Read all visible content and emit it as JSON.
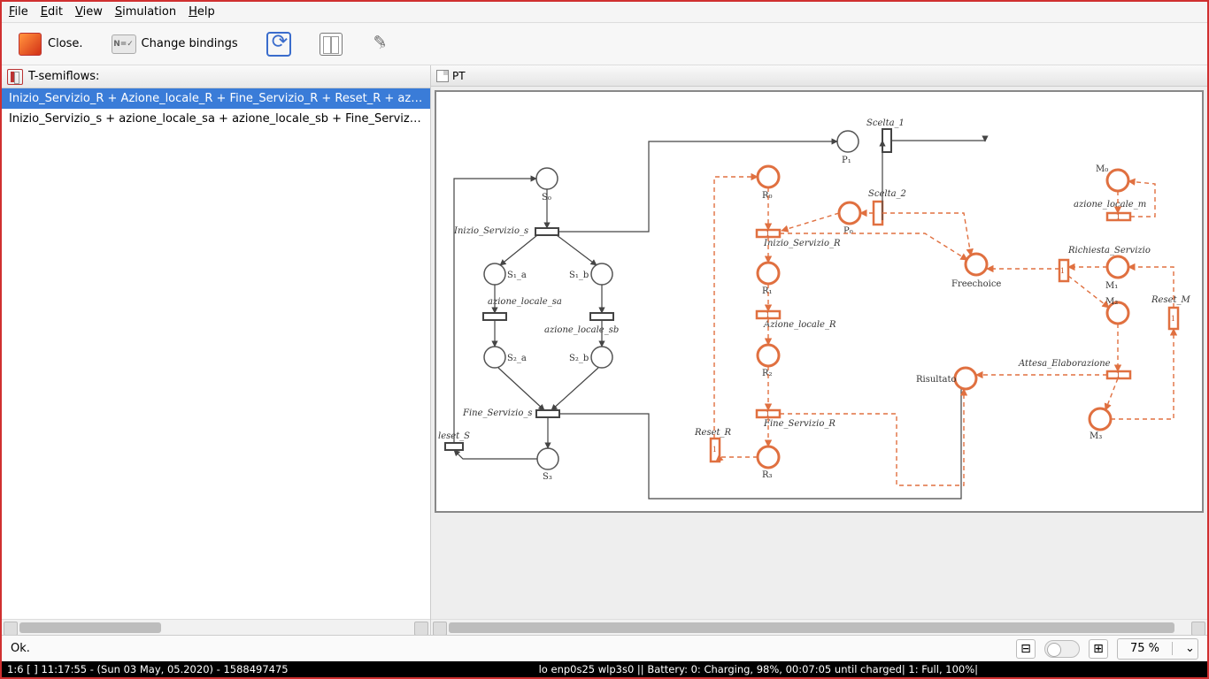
{
  "menu": {
    "file": "File",
    "edit": "Edit",
    "view": "View",
    "simulation": "Simulation",
    "help": "Help"
  },
  "toolbar": {
    "close": "Close.",
    "change_bindings": "Change bindings"
  },
  "left": {
    "title": "T-semiflows:",
    "items": [
      "Inizio_Servizio_R + Azione_locale_R + Fine_Servizio_R + Reset_R + azion",
      "Inizio_Servizio_s + azione_locale_sa + azione_locale_sb + Fine_Servizio_"
    ]
  },
  "canvas": {
    "title": "PT"
  },
  "net": {
    "S0": "S₀",
    "S1a": "S₁_a",
    "S1b": "S₁_b",
    "S2a": "S₂_a",
    "S2b": "S₂_b",
    "S3": "S₃",
    "P0": "P₀",
    "P1": "P₁",
    "R0": "R₀",
    "R1": "R₁",
    "R2": "R₂",
    "R3": "R₃",
    "M0": "M₀",
    "M1": "M₁",
    "M2": "M₂",
    "M3": "M₃",
    "Freechoice": "Freechoice",
    "Risultato": "Risultato",
    "Inizio_Servizio_s": "Inizio_Servizio_s",
    "azione_locale_sa": "azione_locale_sa",
    "azione_locale_sb": "azione_locale_sb",
    "Fine_Servizio_s": "Fine_Servizio_s",
    "Reset_S": "leset_S",
    "Scelta1": "Scelta_1",
    "Scelta2": "Scelta_2",
    "Inizio_Servizio_R": "Inizio_Servizio_R",
    "Azione_locale_R": "Azione_locale_R",
    "Fine_Servizio_R": "Fine_Servizio_R",
    "Reset_R": "Reset_R",
    "azione_locale_m": "azione_locale_m",
    "Richiesta_Servizio": "Richiesta_Servizio",
    "Attesa_Elaborazione": "Attesa_Elaborazione",
    "Reset_M": "Reset_M"
  },
  "footer": {
    "status": "Ok.",
    "zoom": "75 %"
  },
  "statusbar": {
    "left": "1:6 [ ]    11:17:55 - (Sun 03 May, 05.2020) - 1588497475",
    "mid": "lo enp0s25 wlp3s0   ||  Battery: 0: Charging, 98%, 00:07:05 until charged| 1: Full, 100%|"
  }
}
